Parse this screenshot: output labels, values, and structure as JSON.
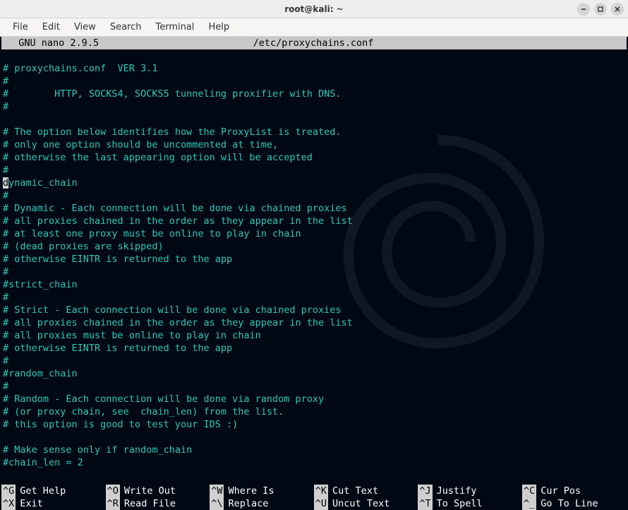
{
  "window": {
    "title": "root@kali: ~"
  },
  "menu": {
    "items": [
      "File",
      "Edit",
      "View",
      "Search",
      "Terminal",
      "Help"
    ]
  },
  "nano": {
    "app_label": "  GNU nano 2.9.5",
    "file_path": "/etc/proxychains.conf"
  },
  "file_lines": [
    "",
    "# proxychains.conf  VER 3.1",
    "#",
    "#        HTTP, SOCKS4, SOCKS5 tunneling proxifier with DNS.",
    "#",
    "",
    "# The option below identifies how the ProxyList is treated.",
    "# only one option should be uncommented at time,",
    "# otherwise the last appearing option will be accepted",
    "#",
    "dynamic_chain",
    "#",
    "# Dynamic - Each connection will be done via chained proxies",
    "# all proxies chained in the order as they appear in the list",
    "# at least one proxy must be online to play in chain",
    "# (dead proxies are skipped)",
    "# otherwise EINTR is returned to the app",
    "#",
    "#strict_chain",
    "#",
    "# Strict - Each connection will be done via chained proxies",
    "# all proxies chained in the order as they appear in the list",
    "# all proxies must be online to play in chain",
    "# otherwise EINTR is returned to the app",
    "#",
    "#random_chain",
    "#",
    "# Random - Each connection will be done via random proxy",
    "# (or proxy chain, see  chain_len) from the list.",
    "# this option is good to test your IDS :)",
    "",
    "# Make sense only if random_chain",
    "#chain_len = 2"
  ],
  "cursor_line_index": 10,
  "shortcuts_row1": [
    {
      "key": "^G",
      "label": "Get Help"
    },
    {
      "key": "^O",
      "label": "Write Out"
    },
    {
      "key": "^W",
      "label": "Where Is"
    },
    {
      "key": "^K",
      "label": "Cut Text"
    },
    {
      "key": "^J",
      "label": "Justify"
    },
    {
      "key": "^C",
      "label": "Cur Pos"
    }
  ],
  "shortcuts_row2": [
    {
      "key": "^X",
      "label": "Exit"
    },
    {
      "key": "^R",
      "label": "Read File"
    },
    {
      "key": "^\\",
      "label": "Replace"
    },
    {
      "key": "^U",
      "label": "Uncut Text"
    },
    {
      "key": "^T",
      "label": "To Spell"
    },
    {
      "key": "^_",
      "label": "Go To Line"
    }
  ]
}
